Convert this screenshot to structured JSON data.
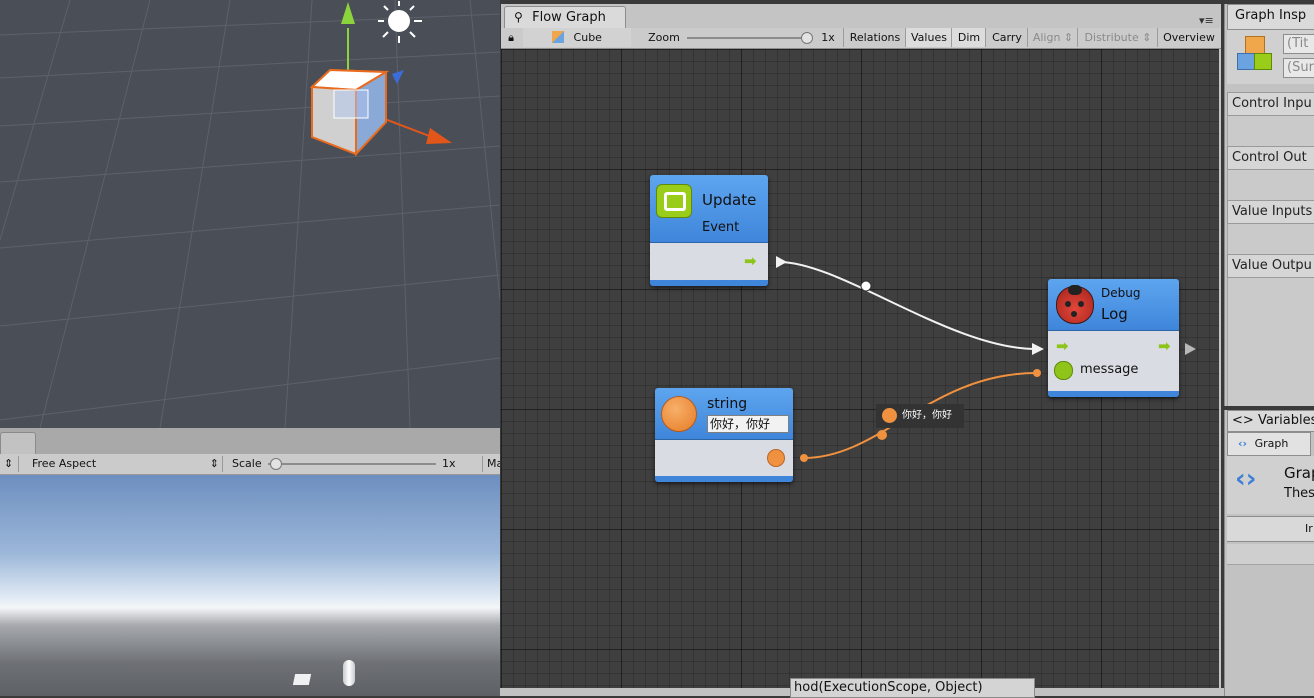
{
  "flow_graph": {
    "tab_title": "Flow Graph",
    "toolbar": {
      "target": "Cube",
      "zoom_label": "Zoom",
      "zoom_value": "1x",
      "buttons": [
        "Relations",
        "Values",
        "Dim",
        "Carry",
        "Align",
        "Distribute",
        "Overview"
      ],
      "disabled": [
        "Align",
        "Distribute"
      ]
    },
    "nodes": {
      "update_event": {
        "title": "Update",
        "subtitle": "Event"
      },
      "string_literal": {
        "title": "string",
        "value": "你好，你好"
      },
      "debug_log": {
        "category": "Debug",
        "title": "Log",
        "port_label": "message"
      }
    },
    "connection_tooltip": "你好，你好",
    "colors": {
      "node_header": "#4a92e4",
      "control_port": "#9acd1a",
      "string_port": "#f0913f",
      "canvas": "#3f3f3f"
    }
  },
  "game_view": {
    "aspect": "Free Aspect",
    "scale_label": "Scale",
    "scale_value": "1x",
    "truncated_button": "Ma"
  },
  "graph_inspector": {
    "tab_title": "Graph Insp",
    "title_placeholder": "(Tit",
    "summary_placeholder": "(Sur",
    "sections": [
      "Control Inpu",
      "Control Out",
      "Value Inputs",
      "Value Outpu"
    ]
  },
  "variables_panel": {
    "tab_title": "Variables",
    "tab_icon": "<>",
    "graph_tab": "Graph",
    "header_title": "Grap",
    "header_desc": "Thes",
    "button": "Ir"
  },
  "console_fragment": "hod(ExecutionScope, Object)"
}
